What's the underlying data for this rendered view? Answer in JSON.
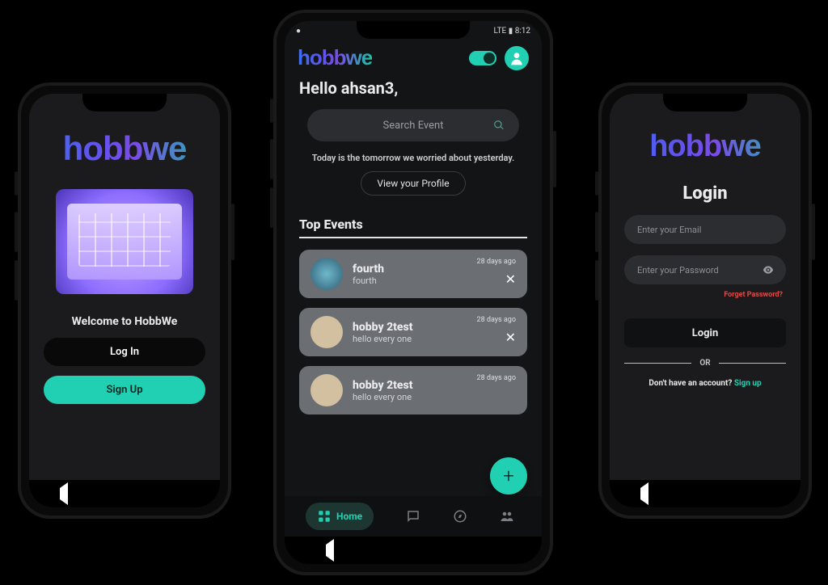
{
  "brand": "hobbwe",
  "phone1": {
    "welcome": "Welcome to HobbWe",
    "login": "Log In",
    "signup": "Sign Up"
  },
  "phone2": {
    "status_left": "●",
    "status_right": "LTE ▮ 8:12",
    "greeting": "Hello ahsan3,",
    "search_placeholder": "Search Event",
    "quote": "Today is the tomorrow we worried about yesterday.",
    "view_profile": "View your Profile",
    "section_title": "Top Events",
    "events": [
      {
        "title": "fourth",
        "sub": "fourth",
        "ago": "28 days ago"
      },
      {
        "title": "hobby 2test",
        "sub": "hello every one",
        "ago": "28 days ago"
      },
      {
        "title": "hobby 2test",
        "sub": "hello every one",
        "ago": "28 days ago"
      }
    ],
    "nav": {
      "home": "Home"
    },
    "fab": "+"
  },
  "phone3": {
    "title": "Login",
    "email_ph": "Enter your Email",
    "password_ph": "Enter your Password",
    "forgot": "Forget Password?",
    "login_btn": "Login",
    "or": "OR",
    "noacct": "Don't have an account? ",
    "signup": "Sign up"
  }
}
